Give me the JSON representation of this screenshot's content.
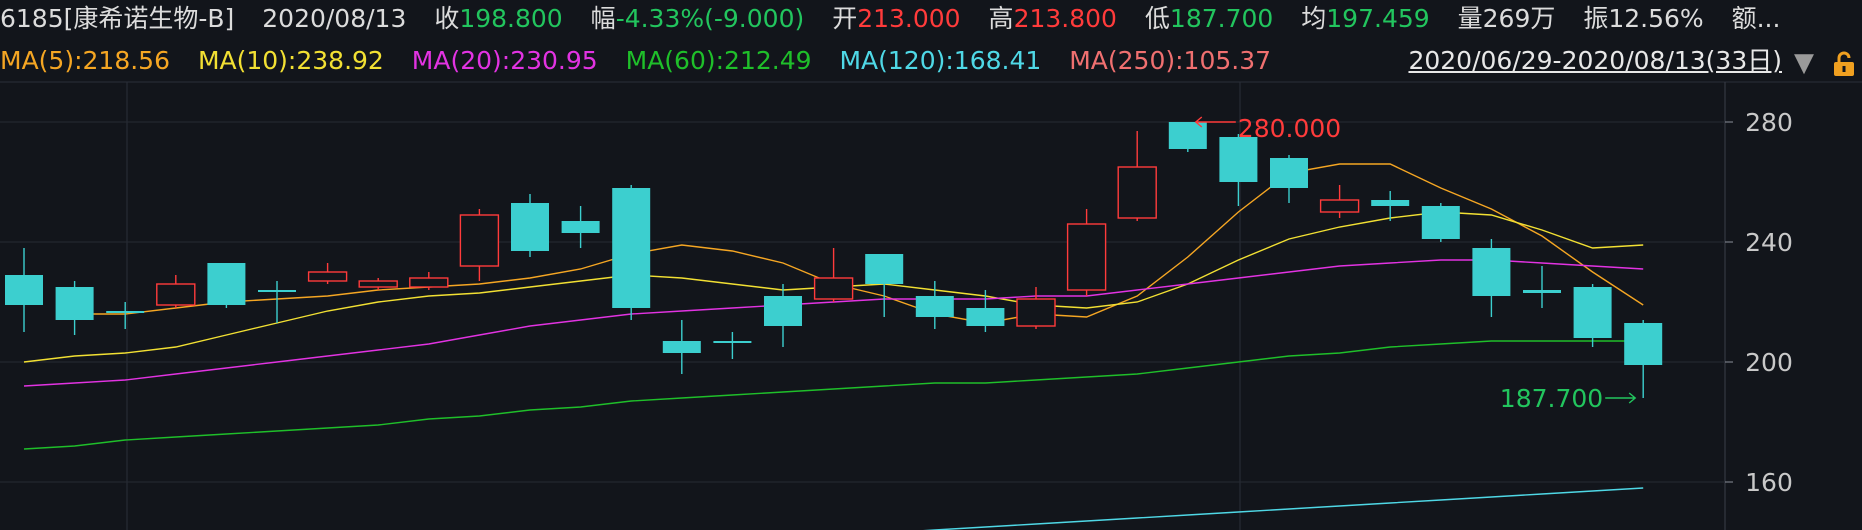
{
  "header": {
    "code_name": "6185[康希诺生物-B]",
    "date": "2020/08/13",
    "close_label": "收",
    "close_value": "198.800",
    "change_label": "幅",
    "change_value": "-4.33%(-9.000)",
    "open_label": "开",
    "open_value": "213.000",
    "high_label": "高",
    "high_value": "213.800",
    "low_label": "低",
    "low_value": "187.700",
    "avg_label": "均",
    "avg_value": "197.459",
    "volume_label": "量",
    "volume_value": "269万",
    "amplitude_label": "振",
    "amplitude_value": "12.56%",
    "amount_label": "额..."
  },
  "ma_legend": [
    {
      "label": "MA(5):218.56",
      "color": "#f5a623"
    },
    {
      "label": "MA(10):238.92",
      "color": "#f2e033"
    },
    {
      "label": "MA(20):230.95",
      "color": "#e233e2"
    },
    {
      "label": "MA(60):212.49",
      "color": "#1fbf2a"
    },
    {
      "label": "MA(120):168.41",
      "color": "#4fd8e6"
    },
    {
      "label": "MA(250):105.37",
      "color": "#f07070"
    }
  ],
  "range_label": "2020/06/29-2020/08/13(33日)",
  "range_arrow": "▼",
  "chart_data": {
    "type": "candlestick",
    "yticks": [
      280,
      240,
      200,
      160
    ],
    "ylim": [
      147,
      293
    ],
    "high_annotation": "280.000",
    "low_annotation": "187.700",
    "up_color": "#ff3b3b",
    "down_color": "#3ccfcf",
    "candles": [
      {
        "o": 229,
        "c": 219,
        "h": 238,
        "l": 210
      },
      {
        "o": 225,
        "c": 214,
        "h": 227,
        "l": 209
      },
      {
        "o": 217,
        "c": 217,
        "h": 220,
        "l": 211
      },
      {
        "o": 219,
        "c": 226,
        "h": 229,
        "l": 218
      },
      {
        "o": 233,
        "c": 219,
        "h": 233,
        "l": 218
      },
      {
        "o": 224,
        "c": 224,
        "h": 227,
        "l": 213
      },
      {
        "o": 227,
        "c": 230,
        "h": 233,
        "l": 226
      },
      {
        "o": 225,
        "c": 227,
        "h": 228,
        "l": 224
      },
      {
        "o": 225,
        "c": 228,
        "h": 230,
        "l": 224
      },
      {
        "o": 232,
        "c": 249,
        "h": 251,
        "l": 227
      },
      {
        "o": 253,
        "c": 237,
        "h": 256,
        "l": 235
      },
      {
        "o": 247,
        "c": 243,
        "h": 252,
        "l": 238
      },
      {
        "o": 258,
        "c": 218,
        "h": 259,
        "l": 214
      },
      {
        "o": 207,
        "c": 203,
        "h": 214,
        "l": 196
      },
      {
        "o": 207,
        "c": 207,
        "h": 210,
        "l": 201
      },
      {
        "o": 222,
        "c": 212,
        "h": 226,
        "l": 205
      },
      {
        "o": 221,
        "c": 228,
        "h": 238,
        "l": 220
      },
      {
        "o": 236,
        "c": 226,
        "h": 236,
        "l": 215
      },
      {
        "o": 222,
        "c": 215,
        "h": 227,
        "l": 211
      },
      {
        "o": 218,
        "c": 212,
        "h": 224,
        "l": 210
      },
      {
        "o": 212,
        "c": 221,
        "h": 225,
        "l": 211
      },
      {
        "o": 224,
        "c": 246,
        "h": 251,
        "l": 222
      },
      {
        "o": 248,
        "c": 265,
        "h": 277,
        "l": 247
      },
      {
        "o": 280,
        "c": 271,
        "h": 280,
        "l": 270
      },
      {
        "o": 275,
        "c": 260,
        "h": 276,
        "l": 252
      },
      {
        "o": 268,
        "c": 258,
        "h": 269,
        "l": 253
      },
      {
        "o": 250,
        "c": 254,
        "h": 259,
        "l": 248
      },
      {
        "o": 254,
        "c": 252,
        "h": 257,
        "l": 247
      },
      {
        "o": 252,
        "c": 241,
        "h": 253,
        "l": 240
      },
      {
        "o": 238,
        "c": 222,
        "h": 241,
        "l": 215
      },
      {
        "o": 224,
        "c": 223,
        "h": 232,
        "l": 218
      },
      {
        "o": 225,
        "c": 208,
        "h": 226,
        "l": 205
      },
      {
        "o": 213,
        "c": 199,
        "h": 214,
        "l": 188
      }
    ],
    "series": [
      {
        "name": "MA(5)",
        "color": "#f5a623",
        "values": [
          null,
          216,
          216,
          218,
          220,
          221,
          222,
          224,
          225,
          226,
          228,
          231,
          236,
          239,
          237,
          233,
          226,
          222,
          216,
          213,
          216,
          215,
          222,
          235,
          250,
          263,
          266,
          266,
          258,
          251,
          242,
          230,
          219
        ]
      },
      {
        "name": "MA(10)",
        "color": "#f2e033",
        "values": [
          200,
          202,
          203,
          205,
          209,
          213,
          217,
          220,
          222,
          223,
          225,
          227,
          229,
          228,
          226,
          224,
          225,
          226,
          224,
          222,
          219,
          218,
          220,
          226,
          234,
          241,
          245,
          248,
          250,
          249,
          244,
          238,
          239
        ]
      },
      {
        "name": "MA(20)",
        "color": "#e233e2",
        "values": [
          192,
          193,
          194,
          196,
          198,
          200,
          202,
          204,
          206,
          209,
          212,
          214,
          216,
          217,
          218,
          219,
          220,
          221,
          221,
          221,
          222,
          222,
          224,
          226,
          228,
          230,
          232,
          233,
          234,
          234,
          233,
          232,
          231
        ]
      },
      {
        "name": "MA(60)",
        "color": "#1fbf2a",
        "values": [
          171,
          172,
          174,
          175,
          176,
          177,
          178,
          179,
          181,
          182,
          184,
          185,
          187,
          188,
          189,
          190,
          191,
          192,
          193,
          193,
          194,
          195,
          196,
          198,
          200,
          202,
          203,
          205,
          206,
          207,
          207,
          207,
          207
        ]
      },
      {
        "name": "MA(120)",
        "color": "#4fd8e6",
        "values": [
          null,
          null,
          null,
          null,
          null,
          null,
          null,
          null,
          null,
          null,
          null,
          null,
          null,
          null,
          140,
          141,
          142,
          143,
          144,
          145,
          146,
          147,
          148,
          149,
          150,
          151,
          152,
          153,
          154,
          155,
          156,
          157,
          158
        ]
      }
    ]
  }
}
